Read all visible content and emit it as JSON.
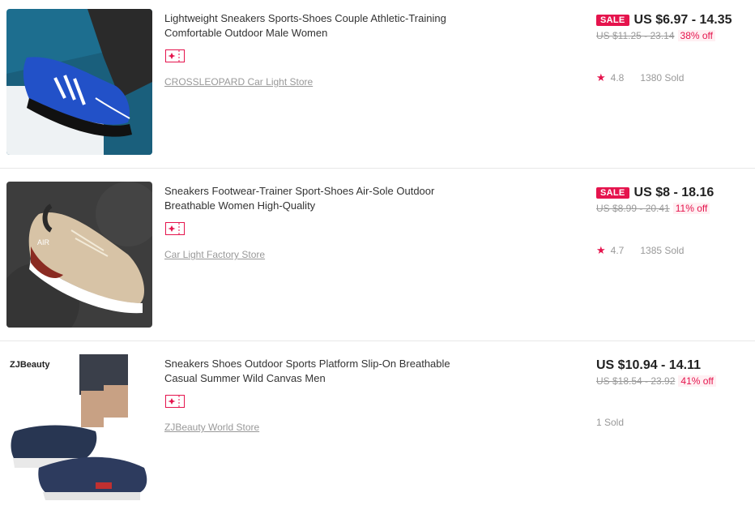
{
  "products": [
    {
      "title": "Lightweight Sneakers Sports-Shoes Couple Athletic-Training Comfortable Outdoor Male Women",
      "store": "CROSSLEOPARD Car Light Store",
      "sale_label": "SALE",
      "price": "US $6.97 - 14.35",
      "original_price": "US $11.25 - 23.14",
      "discount": "38% off",
      "rating": "4.8",
      "sold": "1380 Sold",
      "image_icon": "blue-sneaker-image"
    },
    {
      "title": "Sneakers Footwear-Trainer Sport-Shoes Air-Sole Outdoor Breathable Women High-Quality",
      "store": "Car Light Factory Store",
      "sale_label": "SALE",
      "price": "US $8 - 18.16",
      "original_price": "US $8.99 - 20.41",
      "discount": "11% off",
      "rating": "4.7",
      "sold": "1385 Sold",
      "image_icon": "beige-air-sneaker-image"
    },
    {
      "title": "Sneakers Shoes Outdoor Sports Platform Slip-On Breathable Casual Summer Wild Canvas Men",
      "store": "ZJBeauty World Store",
      "price": "US $10.94 - 14.11",
      "original_price": "US $18.54 - 23.92",
      "discount": "41% off",
      "sold": "1 Sold",
      "image_brand": "ZJBeauty",
      "image_icon": "navy-slip-on-image"
    }
  ],
  "colors": {
    "accent": "#e5144d",
    "muted": "#999999",
    "text": "#333333"
  }
}
